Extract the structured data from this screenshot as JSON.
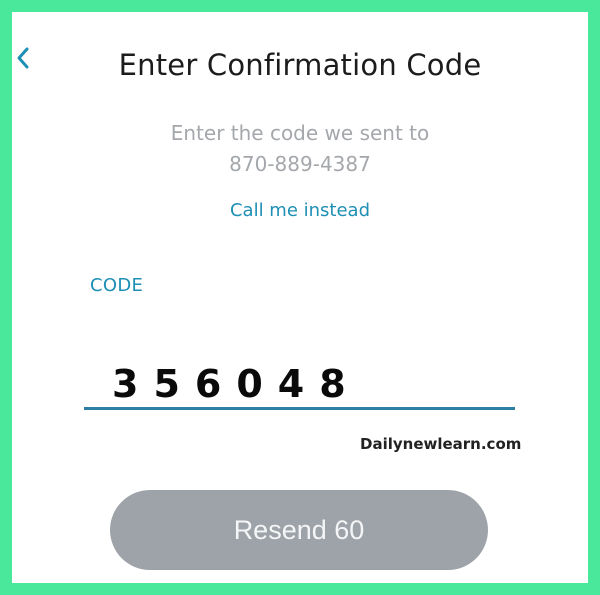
{
  "header": {
    "back_icon": "chevron-left-icon",
    "title": "Enter Confirmation Code"
  },
  "instructions": {
    "line1": "Enter the code we sent to",
    "phone": "870-889-4387"
  },
  "call_link": "Call me instead",
  "code": {
    "label": "CODE",
    "value": "356048"
  },
  "watermark": "Dailynewlearn.com",
  "resend_button": {
    "label": "Resend 60"
  },
  "colors": {
    "frame": "#4ae89a",
    "accent": "#1e8fb5",
    "button": "#9ea3a9"
  }
}
